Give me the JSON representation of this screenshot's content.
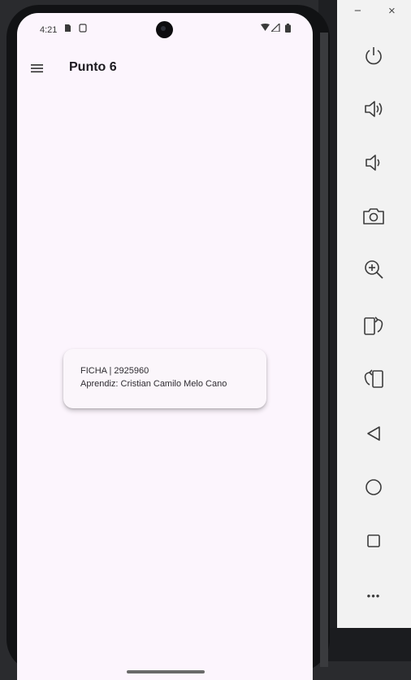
{
  "status_bar": {
    "time": "4:21"
  },
  "app_bar": {
    "title": "Punto 6"
  },
  "card": {
    "line1": "FICHA | 2925960",
    "line2": "Aprendiz: Cristian Camilo Melo Cano"
  },
  "emulator_window": {
    "minimize_label": "−",
    "close_label": "×",
    "more_label": "•••"
  },
  "emulator_controls": [
    {
      "icon": "power-icon"
    },
    {
      "icon": "volume-up-icon"
    },
    {
      "icon": "volume-down-icon"
    },
    {
      "icon": "camera-icon"
    },
    {
      "icon": "zoom-in-icon"
    },
    {
      "icon": "rotate-left-icon"
    },
    {
      "icon": "rotate-right-icon"
    },
    {
      "icon": "back-icon"
    },
    {
      "icon": "home-icon"
    },
    {
      "icon": "overview-icon"
    },
    {
      "icon": "more-icon"
    }
  ],
  "colors": {
    "screen_bg": "#fcf5fd",
    "card_bg": "#fbf6fb",
    "panel_bg": "#f2f2f2"
  }
}
